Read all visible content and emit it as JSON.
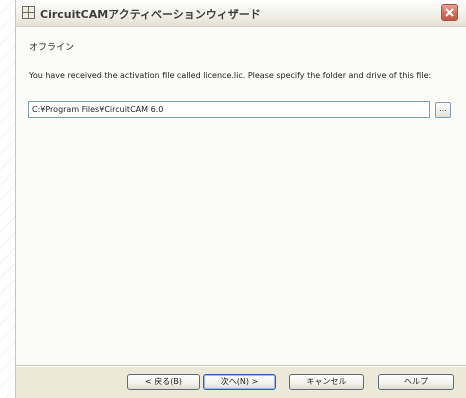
{
  "window": {
    "title": "CircuitCAMアクティベーションウィザード"
  },
  "page": {
    "section_title": "オフライン",
    "instruction": "You have received the activation file called licence.lic. Please specify the folder and drive of this file:",
    "path_value": "C:¥Program Files¥CircuitCAM 6.0",
    "browse_label": "..."
  },
  "buttons": {
    "back": "< 戻る(B)",
    "next": "次へ(N) >",
    "cancel": "キャンセル",
    "help": "ヘルプ"
  },
  "colors": {
    "window_bg": "#ece9d8",
    "content_bg": "#fbfbf7",
    "close_button": "#d4705e",
    "input_border": "#7f9db9"
  },
  "icons": {
    "app": "circuitcam-app-icon",
    "close": "close-icon",
    "browse": "browse-icon"
  }
}
